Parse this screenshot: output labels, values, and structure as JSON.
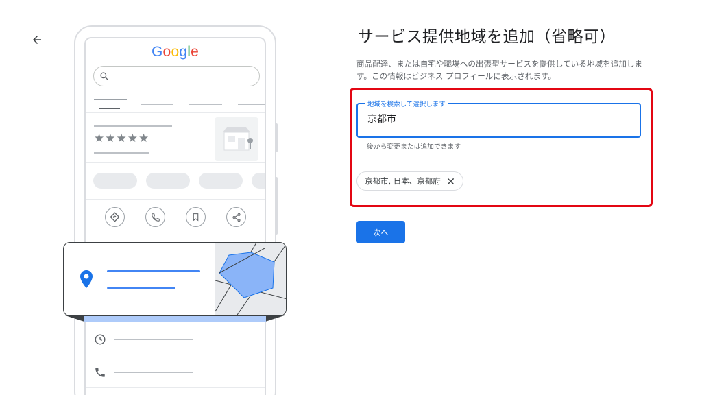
{
  "nav": {
    "back_icon": "arrow-left-icon"
  },
  "illustration": {
    "logo": {
      "letters": [
        {
          "char": "G",
          "color": "#4285F4"
        },
        {
          "char": "o",
          "color": "#EA4335"
        },
        {
          "char": "o",
          "color": "#FBBC05"
        },
        {
          "char": "g",
          "color": "#4285F4"
        },
        {
          "char": "l",
          "color": "#34A853"
        },
        {
          "char": "e",
          "color": "#EA4335"
        }
      ]
    },
    "stars": "★★★★★",
    "icons": [
      "search-icon",
      "storefront-icon",
      "directions-icon",
      "phone-icon",
      "bookmark-icon",
      "share-icon",
      "location-pin-icon",
      "clock-icon"
    ]
  },
  "panel": {
    "title": "サービス提供地域を追加（省略可）",
    "description": "商品配達、または自宅や職場への出張型サービスを提供している地域を追加します。この情報はビジネス プロフィールに表示されます。",
    "search": {
      "label": "地域を検索して選択します",
      "value": "京都市",
      "helper": "後から変更または追加できます"
    },
    "selected_areas": [
      {
        "label": "京都市, 日本、京都府",
        "remove_icon": "close-icon"
      }
    ],
    "next_label": "次へ"
  },
  "colors": {
    "accent": "#1a73e8",
    "highlight": "#e30613",
    "map_polygon": "#8ab4f8"
  }
}
